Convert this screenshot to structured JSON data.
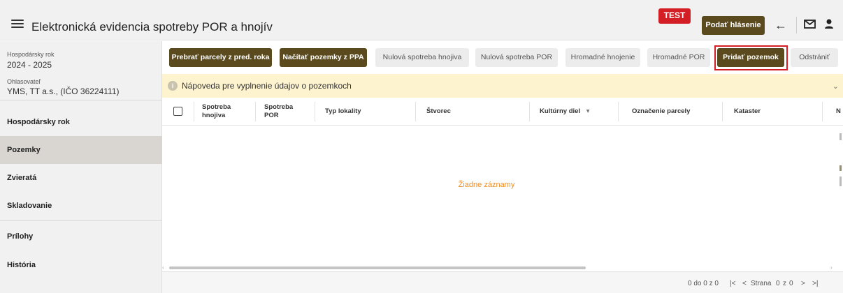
{
  "header": {
    "title": "Elektronická evidencia spotreby POR a hnojív",
    "test_badge": "TEST",
    "report_button": "Podať hlásenie"
  },
  "sidebar": {
    "year_label": "Hospodársky rok",
    "year_value": "2024 - 2025",
    "reporter_label": "Ohlasovateľ",
    "reporter_value": "YMS, TT a.s., (IČO 36224111)",
    "items": [
      {
        "label": "Hospodársky rok",
        "active": false
      },
      {
        "label": "Pozemky",
        "active": true
      },
      {
        "label": "Zvieratá",
        "active": false
      },
      {
        "label": "Skladovanie",
        "active": false
      },
      {
        "label": "Prílohy",
        "active": false
      },
      {
        "label": "História",
        "active": false
      }
    ]
  },
  "toolbar": {
    "buttons": [
      {
        "label": "Prebrať parcely z pred. roka",
        "style": "dark"
      },
      {
        "label": "Načítať pozemky z PPA",
        "style": "dark"
      },
      {
        "label": "Nulová spotreba hnojiva",
        "style": "light"
      },
      {
        "label": "Nulová spotreba POR",
        "style": "light"
      },
      {
        "label": "Hromadné hnojenie",
        "style": "light"
      },
      {
        "label": "Hromadné POR",
        "style": "light"
      },
      {
        "label": "Pridať pozemok",
        "style": "dark"
      },
      {
        "label": "Odstrániť",
        "style": "light"
      }
    ]
  },
  "info": {
    "text": "Nápoveda pre vyplnenie údajov o pozemkoch"
  },
  "grid": {
    "columns": [
      {
        "line1": "Spotreba",
        "line2": "hnojiva"
      },
      {
        "line1": "Spotreba",
        "line2": "POR"
      },
      {
        "line1": "Typ lokality",
        "line2": ""
      },
      {
        "line1": "Štvorec",
        "line2": ""
      },
      {
        "line1": "Kultúrny diel",
        "line2": ""
      },
      {
        "line1": "Označenie parcely",
        "line2": ""
      },
      {
        "line1": "Kataster",
        "line2": ""
      },
      {
        "line1": "N",
        "line2": ""
      }
    ],
    "sort_indicator": "▾",
    "empty_text": "Žiadne záznamy"
  },
  "pager": {
    "summary": "0 do 0 z 0",
    "first": "|<",
    "prev": "<",
    "page_label": "Strana",
    "page_current": "0",
    "of_label": "z",
    "page_total": "0",
    "next": ">",
    "last": ">|"
  },
  "colors": {
    "brand_dark": "#5a4a1e",
    "test_red": "#d31e26",
    "info_bg": "#fdf3cf",
    "empty_orange": "#f08c21"
  }
}
